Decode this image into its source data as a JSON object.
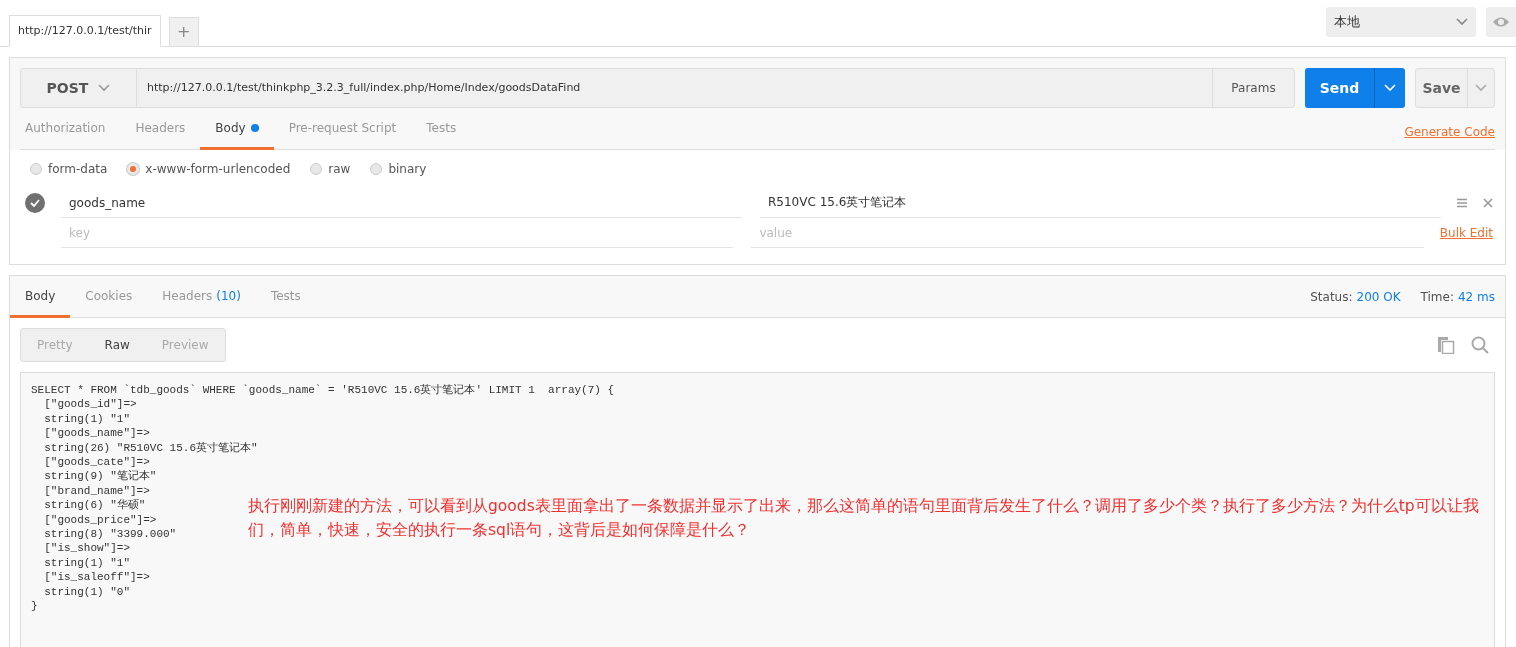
{
  "tabs": [
    {
      "label": "http://127.0.0.1/test/thir",
      "selected": true
    }
  ],
  "new_tab": "+",
  "environment": {
    "value": "本地"
  },
  "request": {
    "method": "POST",
    "url": "http://127.0.0.1/test/thinkphp_3.2.3_full/index.php/Home/Index/goodsDataFind",
    "params": "Params",
    "send": "Send",
    "save": "Save"
  },
  "request_tabs": [
    {
      "label": "Authorization",
      "selected": false,
      "modified": false
    },
    {
      "label": "Headers",
      "selected": false,
      "modified": false
    },
    {
      "label": "Body",
      "selected": true,
      "modified": true
    },
    {
      "label": "Pre-request Script",
      "selected": false,
      "modified": false
    },
    {
      "label": "Tests",
      "selected": false,
      "modified": false
    }
  ],
  "generate_code": "Generate Code",
  "body_types": [
    {
      "label": "form-data",
      "selected": false
    },
    {
      "label": "x-www-form-urlencoded",
      "selected": true
    },
    {
      "label": "raw",
      "selected": false
    },
    {
      "label": "binary",
      "selected": false
    }
  ],
  "params": [
    {
      "checked": true,
      "key": "goods_name",
      "value": "R510VC 15.6英寸笔记本"
    }
  ],
  "new_param": {
    "key_placeholder": "key",
    "value_placeholder": "value"
  },
  "bulk_edit": "Bulk Edit",
  "response_tabs": [
    {
      "label": "Body",
      "selected": true
    },
    {
      "label": "Cookies",
      "selected": false
    },
    {
      "label": "Headers",
      "count": "(10)",
      "selected": false
    },
    {
      "label": "Tests",
      "selected": false
    }
  ],
  "status": {
    "status_label": "Status:",
    "status_value": "200 OK",
    "time_label": "Time:",
    "time_value": "42 ms"
  },
  "view_modes": [
    {
      "label": "Pretty",
      "selected": false
    },
    {
      "label": "Raw",
      "selected": true
    },
    {
      "label": "Preview",
      "selected": false
    }
  ],
  "response_body": [
    "SELECT * FROM `tdb_goods` WHERE `goods_name` = 'R510VC 15.6英寸笔记本' LIMIT 1  array(7) {",
    "  [\"goods_id\"]=>",
    "  string(1) \"1\"",
    "  [\"goods_name\"]=>",
    "  string(26) \"R510VC 15.6英寸笔记本\"",
    "  [\"goods_cate\"]=>",
    "  string(9) \"笔记本\"",
    "  [\"brand_name\"]=>",
    "  string(6) \"华硕\"",
    "  [\"goods_price\"]=>",
    "  string(8) \"3399.000\"",
    "  [\"is_show\"]=>",
    "  string(1) \"1\"",
    "  [\"is_saleoff\"]=>",
    "  string(1) \"0\"",
    "}"
  ],
  "annotation": "执行刚刚新建的方法，可以看到从goods表里面拿出了一条数据并显示了出来，那么这简单的语句里面背后发生了什么？调用了多少个类？执行了多少方法？为什么tp可以让我们，简单，快速，安全的执行一条sql语句，这背后是如何保障是什么？"
}
